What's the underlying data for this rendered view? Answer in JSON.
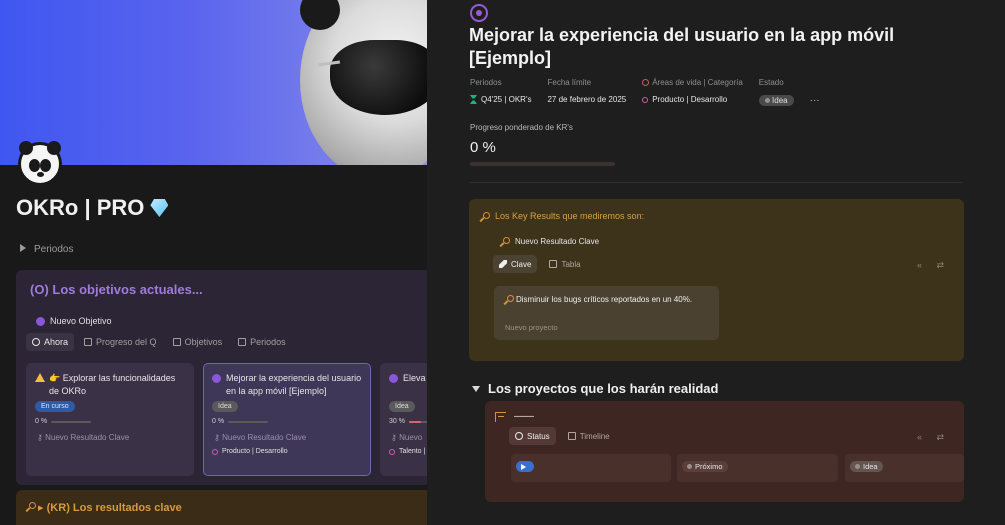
{
  "left_page": {
    "title": "OKRo | PRO",
    "toggle_label": "Periodos",
    "objectives_callout": {
      "title": "(O) Los objetivos actuales...",
      "new_button": "Nuevo Objetivo",
      "tabs": [
        "Ahora",
        "Progreso del Q",
        "Objetivos",
        "Periodos"
      ],
      "cards": [
        {
          "title": "👉 Explorar las funcionalidades de OKRo",
          "status": "En curso",
          "percent": "0 %",
          "kr_link": "Nuevo Resultado Clave",
          "tag": ""
        },
        {
          "title": "Mejorar la experiencia del usuario en la app móvil [Ejemplo]",
          "status": "Idea",
          "percent": "0 %",
          "kr_link": "Nuevo Resultado Clave",
          "tag": "Producto | Desarrollo"
        },
        {
          "title": "Eleva en los [Ejem",
          "status": "Idea",
          "percent": "30 %",
          "kr_link": "Nuevo",
          "tag": "Talento |"
        }
      ]
    },
    "kr_callout": {
      "title": "(KR) Los resultados clave"
    }
  },
  "right_page": {
    "title": "Mejorar la experiencia del usuario en la app móvil [Ejemplo]",
    "properties": {
      "periodos": {
        "label": "Periodos",
        "value": "Q4'25 | OKR's"
      },
      "fecha": {
        "label": "Fecha límite",
        "value": "27 de febrero de 2025"
      },
      "areas": {
        "label": "Áreas de vida | Categoría",
        "value": "Producto | Desarrollo"
      },
      "estado": {
        "label": "Estado",
        "value": "Idea"
      },
      "more": "···"
    },
    "progress": {
      "label": "Progreso ponderado de KR's",
      "value": "0 %",
      "fraction": 0
    },
    "kr_box": {
      "header": "Los Key Results que mediremos son:",
      "new_kr": "Nuevo Resultado Clave",
      "tabs": [
        "Clave",
        "Tabla"
      ],
      "controls": "«  ⇄",
      "card": {
        "title": "Disminuir los bugs críticos reportados en un 40%.",
        "sub": "Nuevo proyecto"
      }
    },
    "projects": {
      "heading": "Los proyectos que los harán realidad",
      "db_title": "——",
      "tabs": [
        "Status",
        "Timeline"
      ],
      "controls": "«  ⇄",
      "columns": [
        "",
        "Próximo",
        "Idea"
      ]
    }
  },
  "colors": {
    "accent_purple": "#a07bd8",
    "kr_orange": "#d6a14a",
    "status_blue": "#2f5aa8"
  }
}
